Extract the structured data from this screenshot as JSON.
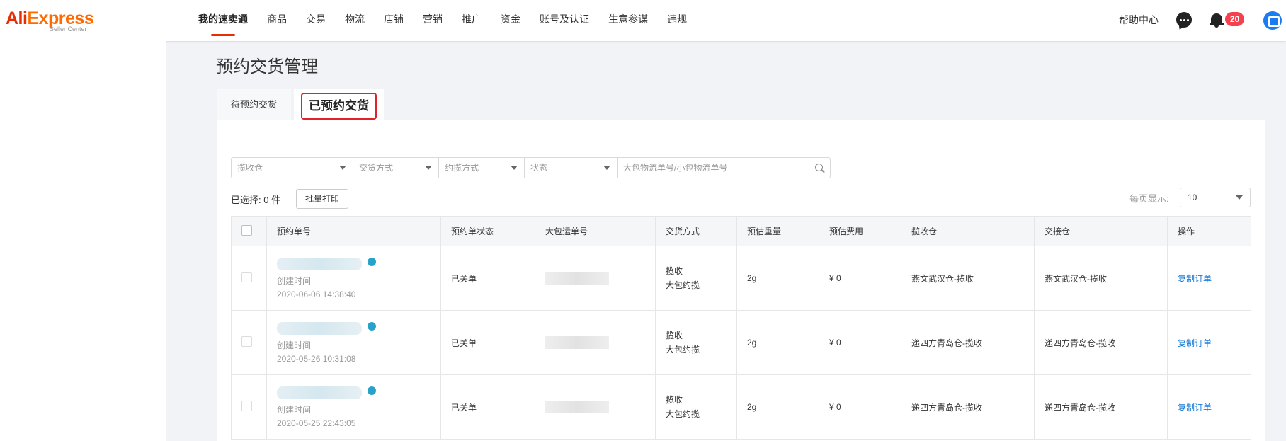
{
  "header": {
    "logo_brand_part1": "Ali",
    "logo_brand_part2": "Express",
    "logo_sub": "Seller Center",
    "nav": [
      {
        "label": "我的速卖通",
        "active": true
      },
      {
        "label": "商品"
      },
      {
        "label": "交易"
      },
      {
        "label": "物流"
      },
      {
        "label": "店铺"
      },
      {
        "label": "营销"
      },
      {
        "label": "推广"
      },
      {
        "label": "资金"
      },
      {
        "label": "账号及认证"
      },
      {
        "label": "生意参谋"
      },
      {
        "label": "违规"
      }
    ],
    "help": "帮助中心",
    "notification_count": "20"
  },
  "page": {
    "title": "预约交货管理",
    "tabs": [
      {
        "label": "待预约交货"
      },
      {
        "label": "已预约交货",
        "active": true
      }
    ]
  },
  "filters": {
    "warehouse_placeholder": "揽收仓",
    "delivery_method_placeholder": "交货方式",
    "pickup_method_placeholder": "约揽方式",
    "status_placeholder": "状态",
    "search_placeholder": "大包物流单号/小包物流单号"
  },
  "toolbar": {
    "selected_text": "已选择: 0 件",
    "batch_print": "批量打印",
    "per_page_label": "每页显示:",
    "per_page_value": "10"
  },
  "table": {
    "headers": [
      "预约单号",
      "预约单状态",
      "大包运单号",
      "交货方式",
      "预估重量",
      "预估费用",
      "揽收仓",
      "交接仓",
      "操作"
    ],
    "rows": [
      {
        "created_label": "创建时间",
        "created_time": "2020-06-06 14:38:40",
        "status": "已关单",
        "method_line1": "揽收",
        "method_line2": "大包约揽",
        "weight": "2g",
        "fee": "¥ 0",
        "pickup_warehouse": "燕文武汉仓-揽收",
        "handover_warehouse": "燕文武汉仓-揽收",
        "action": "复制订单"
      },
      {
        "created_label": "创建时间",
        "created_time": "2020-05-26 10:31:08",
        "status": "已关单",
        "method_line1": "揽收",
        "method_line2": "大包约揽",
        "weight": "2g",
        "fee": "¥ 0",
        "pickup_warehouse": "递四方青岛仓-揽收",
        "handover_warehouse": "递四方青岛仓-揽收",
        "action": "复制订单"
      },
      {
        "created_label": "创建时间",
        "created_time": "2020-05-25 22:43:05",
        "status": "已关单",
        "method_line1": "揽收",
        "method_line2": "大包约揽",
        "weight": "2g",
        "fee": "¥ 0",
        "pickup_warehouse": "递四方青岛仓-揽收",
        "handover_warehouse": "递四方青岛仓-揽收",
        "action": "复制订单"
      }
    ]
  },
  "colors": {
    "brand_red": "#e62e04",
    "brand_orange": "#ff6a00",
    "link_blue": "#1a7cd8",
    "badge_red": "#f5414d",
    "highlight_border": "#e0222a"
  }
}
